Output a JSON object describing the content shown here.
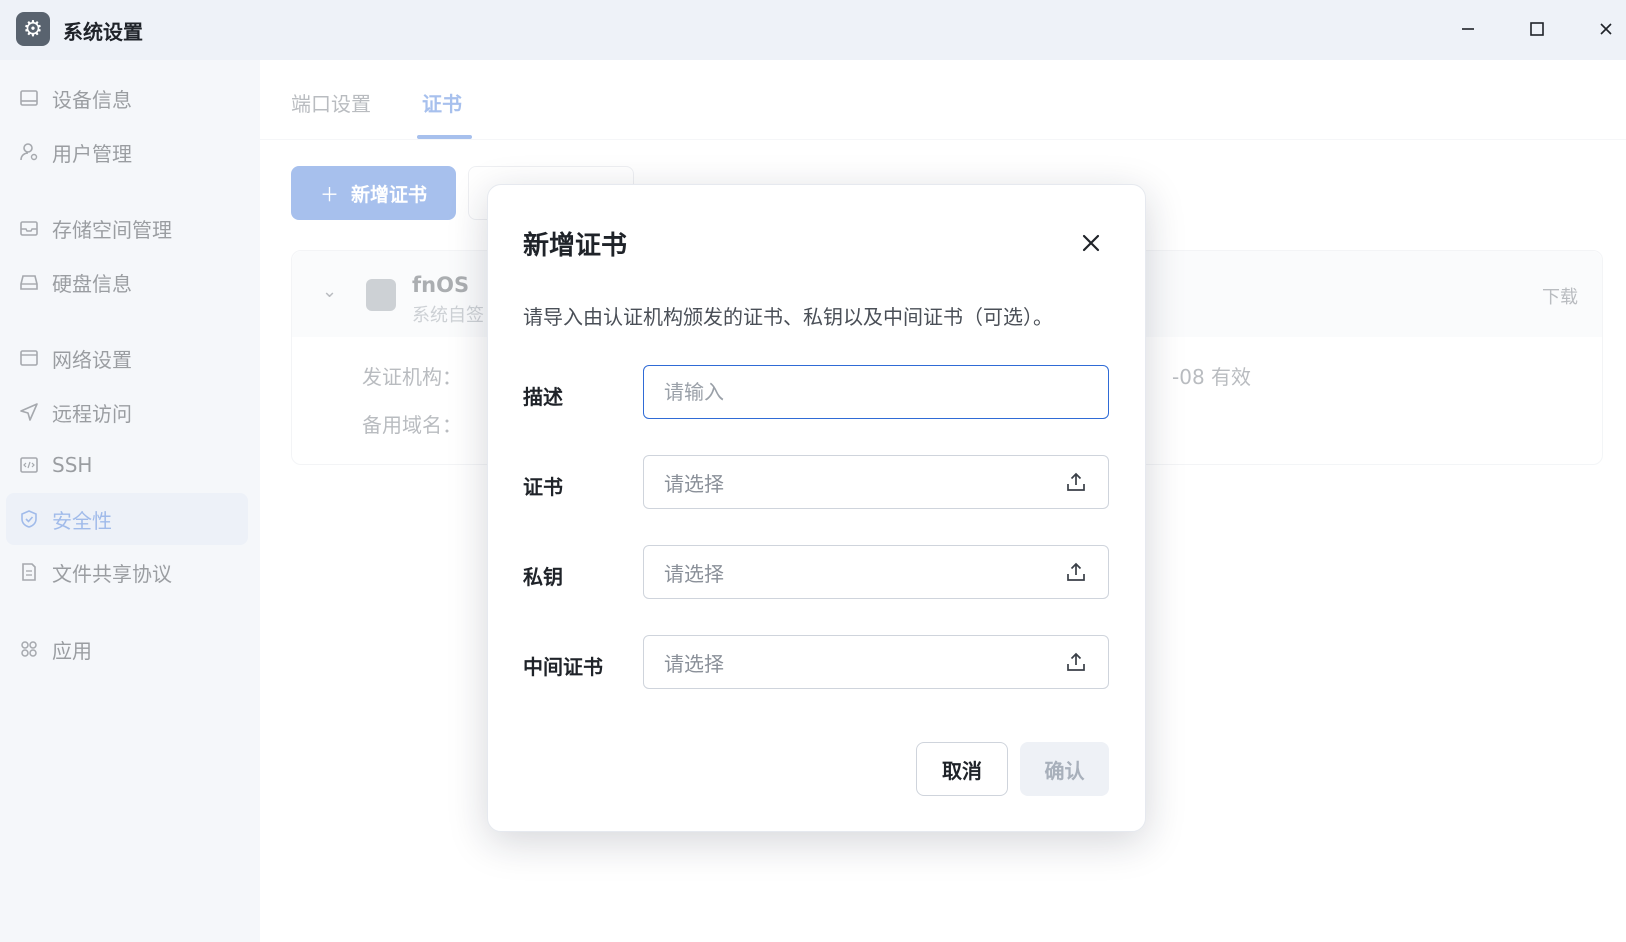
{
  "window": {
    "title": "系统设置"
  },
  "sidebar": {
    "items": [
      {
        "label": "设备信息",
        "icon": "monitor-icon"
      },
      {
        "label": "用户管理",
        "icon": "user-gear-icon"
      },
      {
        "label": "存储空间管理",
        "icon": "storage-icon"
      },
      {
        "label": "硬盘信息",
        "icon": "disk-icon"
      },
      {
        "label": "网络设置",
        "icon": "network-icon"
      },
      {
        "label": "远程访问",
        "icon": "send-icon"
      },
      {
        "label": "SSH",
        "icon": "code-icon"
      },
      {
        "label": "安全性",
        "icon": "shield-icon",
        "active": true
      },
      {
        "label": "文件共享协议",
        "icon": "document-icon"
      },
      {
        "label": "应用",
        "icon": "apps-icon"
      }
    ]
  },
  "main": {
    "tabs": [
      {
        "label": "端口设置"
      },
      {
        "label": "证书",
        "active": true
      }
    ],
    "add_button": "新增证书",
    "cert": {
      "name": "fnOS",
      "subtitle": "系统自签",
      "download": "下载",
      "issuer_label": "发证机构：",
      "san_label": "备用域名：",
      "validity": "-08 有效"
    }
  },
  "modal": {
    "title": "新增证书",
    "description": "请导入由认证机构颁发的证书、私钥以及中间证书（可选）。",
    "fields": {
      "description": {
        "label": "描述",
        "placeholder": "请输入",
        "value": ""
      },
      "certificate": {
        "label": "证书",
        "placeholder": "请选择"
      },
      "private_key": {
        "label": "私钥",
        "placeholder": "请选择"
      },
      "intermediate": {
        "label": "中间证书",
        "placeholder": "请选择"
      }
    },
    "cancel_label": "取消",
    "confirm_label": "确认"
  },
  "colors": {
    "accent": "#2f6bd6",
    "text": "#1f2329",
    "muted": "#8a9099"
  }
}
